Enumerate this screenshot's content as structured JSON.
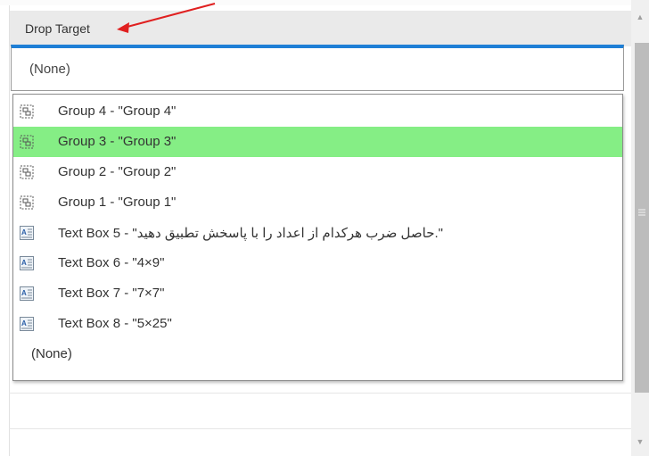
{
  "property": {
    "label": "Drop Target",
    "selected_value": "(None)"
  },
  "dropdown": {
    "items": [
      {
        "label": "Group 4 - \"Group 4\"",
        "icon": "group-icon"
      },
      {
        "label": "Group 3 - \"Group 3\"",
        "icon": "group-icon",
        "selected": true
      },
      {
        "label": "Group 2 - \"Group 2\"",
        "icon": "group-icon"
      },
      {
        "label": "Group 1 - \"Group 1\"",
        "icon": "group-icon"
      },
      {
        "label": "Text Box 5 - \"حاصل ضرب هرکدام از اعداد را با پاسخش تطبیق دهید.\"",
        "icon": "text-box-icon"
      },
      {
        "label": "Text Box 6 - \"4×9\"",
        "icon": "text-box-icon"
      },
      {
        "label": "Text Box 7 - \"7×7\"",
        "icon": "text-box-icon"
      },
      {
        "label": "Text Box 8 - \"5×25\"",
        "icon": "text-box-icon"
      },
      {
        "label": "(None)"
      }
    ]
  },
  "colors": {
    "selected_highlight": "#85ee85",
    "focus_border": "#1e7fd6",
    "annotation_arrow": "#e02020"
  }
}
